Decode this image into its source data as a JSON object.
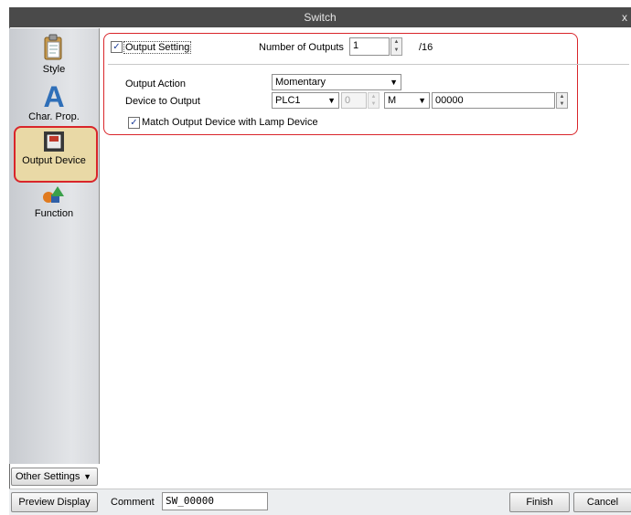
{
  "window": {
    "title": "Switch",
    "close_glyph": "x"
  },
  "sidebar": {
    "items": [
      {
        "label": "Style",
        "icon": "clipboard-icon"
      },
      {
        "label": "Char. Prop.",
        "icon": "letter-a-icon"
      },
      {
        "label": "Output Device",
        "icon": "switch-icon",
        "selected": true
      },
      {
        "label": "Function",
        "icon": "shapes-icon"
      }
    ],
    "other_settings_label": "Other Settings"
  },
  "output": {
    "output_setting_label": "Output Setting",
    "output_setting_checked": true,
    "num_outputs_label": "Number of Outputs",
    "num_outputs_value": "1",
    "num_outputs_max": "/16",
    "output_action_label": "Output Action",
    "output_action_value": "Momentary",
    "device_to_output_label": "Device to Output",
    "plc_value": "PLC1",
    "station_value": "0",
    "device_type_value": "M",
    "address_value": "00000",
    "match_label": "Match Output Device with Lamp Device",
    "match_checked": true
  },
  "footer": {
    "preview_label": "Preview Display",
    "comment_label": "Comment",
    "comment_value": "SW_00000",
    "finish_label": "Finish",
    "cancel_label": "Cancel"
  },
  "colors": {
    "highlight": "#d9252a",
    "titlebar": "#4a4a4a"
  }
}
